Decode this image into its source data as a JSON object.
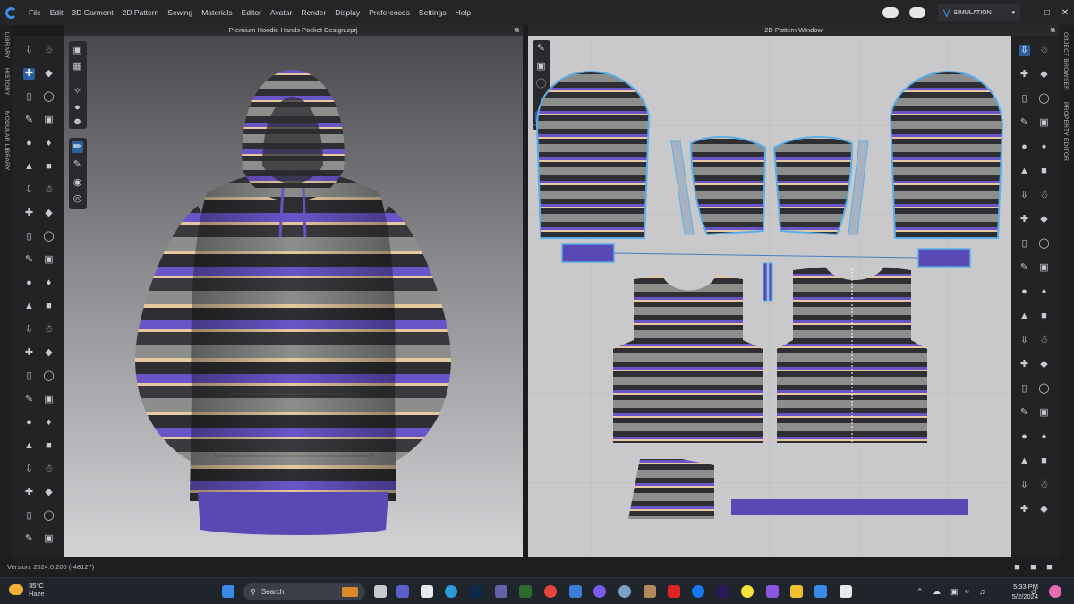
{
  "app": {
    "menus": [
      "File",
      "Edit",
      "3D Garment",
      "2D Pattern",
      "Sewing",
      "Materials",
      "Editor",
      "Avatar",
      "Render",
      "Display",
      "Preferences",
      "Settings",
      "Help"
    ],
    "mode_label": "SIMULATION",
    "window_controls": [
      "minimize",
      "maximize",
      "close"
    ]
  },
  "side_tabs_left": [
    "LIBRARY",
    "HISTORY",
    "MODULAR LIBRARY"
  ],
  "side_tabs_right": [
    "OBJECT BROWSER",
    "PROPERTY EDITOR"
  ],
  "view3d": {
    "title": "Premium Hoodie Hands Pocket Design.zprj"
  },
  "view2d": {
    "title": "2D Pattern Window"
  },
  "status": {
    "version": "Version: 2024.0.200 (r48127)"
  },
  "colors": {
    "accent": "#3d8ee0",
    "stripe_purple": "#6a55c8",
    "stripe_dark": "#2f2f33",
    "stripe_grey": "#8a8d8a",
    "stripe_cream": "#e6c9a0",
    "pattern_outline": "#5aaee8"
  },
  "taskbar": {
    "weather_temp": "35°C",
    "weather_desc": "Haze",
    "search_placeholder": "Search",
    "time": "5:33 PM",
    "date": "5/2/2024",
    "apps": [
      "start-icon",
      "search-icon",
      "file-explorer-icon",
      "teams-icon",
      "store-icon",
      "edge-icon",
      "photoshop-icon",
      "teams-icon",
      "pt-icon",
      "chrome-icon",
      "photos-icon",
      "clipchamp-icon",
      "settings-icon",
      "media-icon",
      "youtube-icon",
      "facebook-icon",
      "premiere-icon",
      "snapchat-icon",
      "folder-icon",
      "folder-icon",
      "notepad-icon",
      "clo-icon"
    ]
  }
}
